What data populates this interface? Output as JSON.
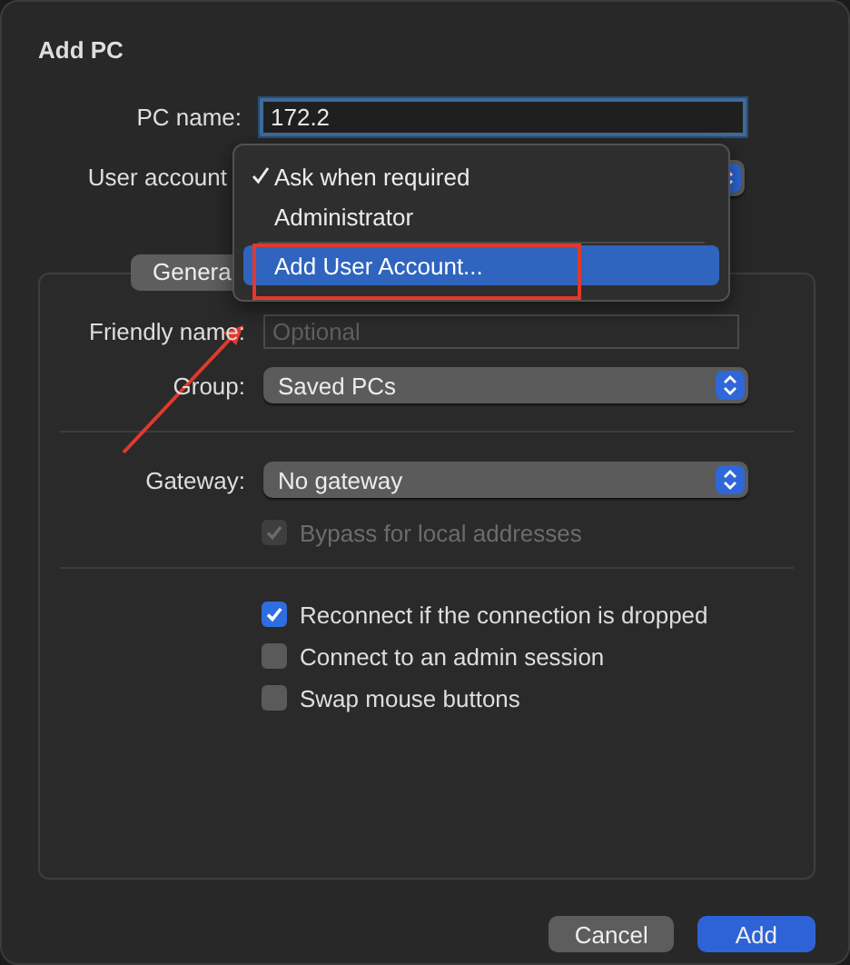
{
  "window": {
    "title": "Add PC"
  },
  "fields": [
    {
      "kind": "text",
      "label": "PC name:",
      "value": "172.2",
      "focused": true
    },
    {
      "kind": "popup",
      "label": "User account"
    }
  ],
  "tabs": [
    {
      "label": "Genera",
      "selected": true
    }
  ],
  "general": [
    {
      "kind": "text",
      "label": "Friendly name:",
      "placeholder": "Optional"
    },
    {
      "kind": "popup",
      "label": "Group:",
      "value": "Saved PCs"
    },
    {
      "kind": "separator"
    },
    {
      "kind": "popup",
      "label": "Gateway:",
      "value": "No gateway"
    },
    {
      "kind": "checkbox",
      "label": "Bypass for local addresses",
      "checked": true,
      "disabled": true
    },
    {
      "kind": "separator"
    },
    {
      "kind": "checkbox",
      "label": "Reconnect if the connection is dropped",
      "checked": true,
      "disabled": false
    },
    {
      "kind": "checkbox",
      "label": "Connect to an admin session",
      "checked": false,
      "disabled": false
    },
    {
      "kind": "checkbox",
      "label": "Swap mouse buttons",
      "checked": false,
      "disabled": false
    }
  ],
  "buttons": [
    {
      "label": "Cancel",
      "primary": false
    },
    {
      "label": "Add",
      "primary": true
    }
  ],
  "menu": [
    {
      "kind": "item",
      "label": "Ask when required",
      "checked": true,
      "selected": false
    },
    {
      "kind": "item",
      "label": "Administrator",
      "checked": false,
      "selected": false
    },
    {
      "kind": "separator"
    },
    {
      "kind": "item",
      "label": "Add User Account...",
      "checked": false,
      "selected": true
    }
  ],
  "annotations": {
    "frame": true,
    "arrow": true
  }
}
